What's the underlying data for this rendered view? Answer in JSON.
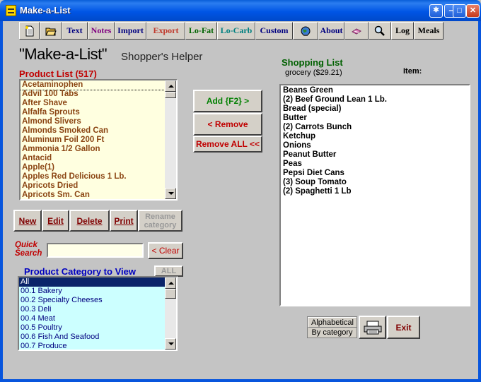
{
  "window": {
    "title": "Make-a-List"
  },
  "toolbar": {
    "buttons": [
      {
        "label": "",
        "icon": "new-document-icon"
      },
      {
        "label": "",
        "icon": "open-folder-icon"
      },
      {
        "label": "Text",
        "color": "#000080"
      },
      {
        "label": "Notes",
        "color": "#800080"
      },
      {
        "label": "Import",
        "color": "#000080"
      },
      {
        "label": "Export",
        "color": "#c0392b"
      },
      {
        "label": "Lo-Fat",
        "color": "#006400"
      },
      {
        "label": "Lo-Carb",
        "color": "#008080"
      },
      {
        "label": "Custom",
        "color": "#000080"
      },
      {
        "label": "",
        "icon": "globe-icon"
      },
      {
        "label": "About",
        "color": "#000080"
      },
      {
        "label": "",
        "icon": "coupon-icon"
      },
      {
        "label": "",
        "icon": "magnifier-icon"
      },
      {
        "label": "Log",
        "color": "#000000"
      },
      {
        "label": "Meals",
        "color": "#000000"
      }
    ]
  },
  "header": {
    "title": "\"Make-a-List\"",
    "subtitle": "Shopper's Helper"
  },
  "product_list": {
    "label": "Product List (517)",
    "items": [
      "Acetaminophen",
      "Advil 100 Tabs",
      "After Shave",
      "Alfalfa Sprouts",
      "Almond Slivers",
      "Almonds Smoked Can",
      "Aluminum Foil 200 Ft",
      "Ammonia 1/2 Gallon",
      "Antacid",
      "Apple(1)",
      "Apples Red Delicious 1 Lb.",
      "Apricots Dried",
      "Apricots Sm. Can"
    ],
    "selected_index": 0
  },
  "list_actions": {
    "add": "Add {F2} >",
    "remove": "< Remove",
    "remove_all": "Remove ALL <<"
  },
  "product_buttons": {
    "new": "New",
    "edit": "Edit",
    "delete": "Delete",
    "print": "Print",
    "rename": "Rename category"
  },
  "quick_search": {
    "label": "Quick Search",
    "value": "",
    "clear": "< Clear"
  },
  "category": {
    "label": "Product Category to View",
    "all_button": "ALL",
    "items": [
      "All",
      "00.1 Bakery",
      "00.2 Specialty Cheeses",
      "00.3 Deli",
      "00.4 Meat",
      "00.5 Poultry",
      "00.6 Fish And Seafood",
      "00.7 Produce"
    ],
    "selected_index": 0
  },
  "shopping_list": {
    "label": "Shopping List",
    "subtitle": "grocery ($29.21)",
    "item_label": "Item:",
    "items": [
      "    Beans Green",
      "(2) Beef Ground Lean 1 Lb.",
      "    Bread (special)",
      "    Butter",
      "(2) Carrots Bunch",
      "    Ketchup",
      "    Onions",
      "    Peanut Butter",
      "    Peas",
      "    Pepsi Diet Cans",
      "(3) Soup Tomato",
      "(2) Spaghetti   1 Lb"
    ]
  },
  "sort": {
    "alphabetical": "Alphabetical",
    "by_category": "By category"
  },
  "exit_label": "Exit",
  "colors": {
    "product_bg": "#ffffe0",
    "category_bg": "#ccffff",
    "selection": "#0a246a",
    "product_text": "#8b4513",
    "label_red": "#c00000",
    "label_blue": "#0000c0",
    "label_green": "#006000"
  }
}
